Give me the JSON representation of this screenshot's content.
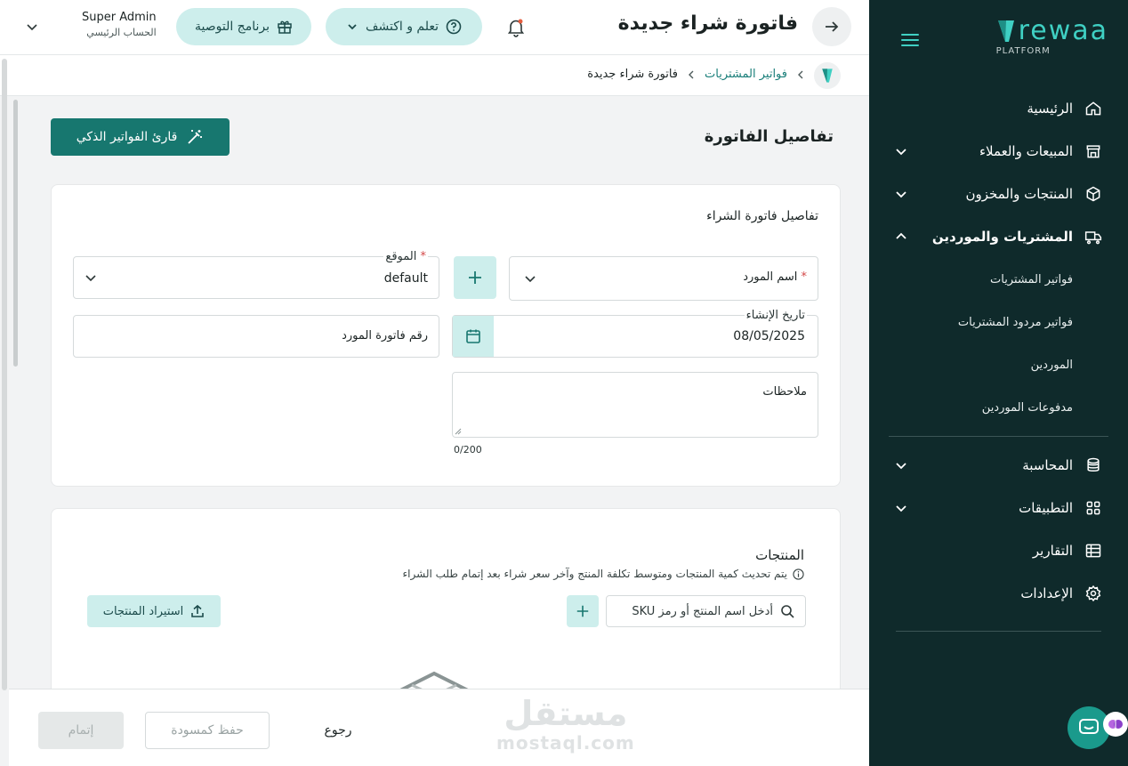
{
  "colors": {
    "sidebar_bg": "#0f2a2b",
    "accent": "#17776f",
    "accent_light": "#cdeeec",
    "brand_teal": "#3fd0c3",
    "required": "#d34848"
  },
  "sidebar": {
    "logo_text": "rewaa",
    "logo_sub": "PLATFORM",
    "items": [
      {
        "label": "الرئيسية",
        "icon": "home-icon",
        "expandable": false
      },
      {
        "label": "المبيعات والعملاء",
        "icon": "store-icon",
        "expandable": true
      },
      {
        "label": "المنتجات والمخزون",
        "icon": "box-icon",
        "expandable": true
      },
      {
        "label": "المشتريات والموردين",
        "icon": "truck-icon",
        "expandable": true,
        "expanded": true,
        "children": [
          "فواتير المشتريات",
          "فواتير مردود المشتريات",
          "الموردين",
          "مدفوعات الموردين"
        ]
      },
      {
        "label": "المحاسبة",
        "icon": "coins-icon",
        "expandable": true
      },
      {
        "label": "التطبيقات",
        "icon": "grid-icon",
        "expandable": true
      },
      {
        "label": "التقارير",
        "icon": "table-icon",
        "expandable": false
      },
      {
        "label": "الإعدادات",
        "icon": "gear-icon",
        "expandable": false
      }
    ]
  },
  "topbar": {
    "title": "فاتورة شراء جديدة",
    "learn_label": "تعلم و اكتشف",
    "referral_label": "برنامج التوصية",
    "user_name": "Super Admin",
    "user_role": "الحساب الرئيسي"
  },
  "breadcrumb": {
    "link": "فواتير المشتريات",
    "current": "فاتورة شراء جديدة"
  },
  "main": {
    "section_title": "تفاصيل الفاتورة",
    "smart_reader_label": "قارئ الفواتير الذكي",
    "details_card": {
      "title": "تفاصيل فاتورة الشراء",
      "supplier_label": "اسم المورد",
      "required_mark": "*",
      "location_label": "الموقع",
      "location_value": "default",
      "date_label": "تاريخ الإنشاء",
      "date_value": "08/05/2025",
      "invoice_no_placeholder": "رقم فاتورة المورد",
      "notes_label": "ملاحظات",
      "notes_counter": "0/200"
    },
    "products_card": {
      "title": "المنتجات",
      "note": "يتم تحديث كمية المنتجات ومتوسط تكلفة المنتج وآخر سعر شراء بعد إتمام طلب الشراء",
      "search_placeholder": "أدخل اسم المنتج أو رمز SKU",
      "import_label": "استيراد المنتجات"
    }
  },
  "footer": {
    "back_label": "رجوع",
    "draft_label": "حفظ كمسودة",
    "complete_label": "إتمام"
  },
  "watermark": {
    "arabic": "مستقل",
    "latin": "mostaql.com"
  }
}
